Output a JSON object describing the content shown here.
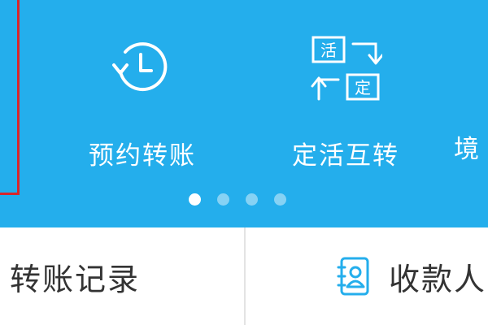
{
  "services": [
    {
      "label": "预约转账",
      "icon": "scheduled-clock-icon"
    },
    {
      "label": "定活互转",
      "icon": "fixed-demand-swap-icon",
      "icon_text": [
        "活",
        "定"
      ]
    }
  ],
  "partial_service": {
    "label": "境"
  },
  "pager": {
    "total": 4,
    "active_index": 0
  },
  "bottom": {
    "record_label": "转账记录",
    "payee_label": "收款人"
  },
  "colors": {
    "banner": "#24aeec",
    "highlight": "#d9252b",
    "text_dark": "#333333",
    "icon_blue": "#24aeec"
  }
}
